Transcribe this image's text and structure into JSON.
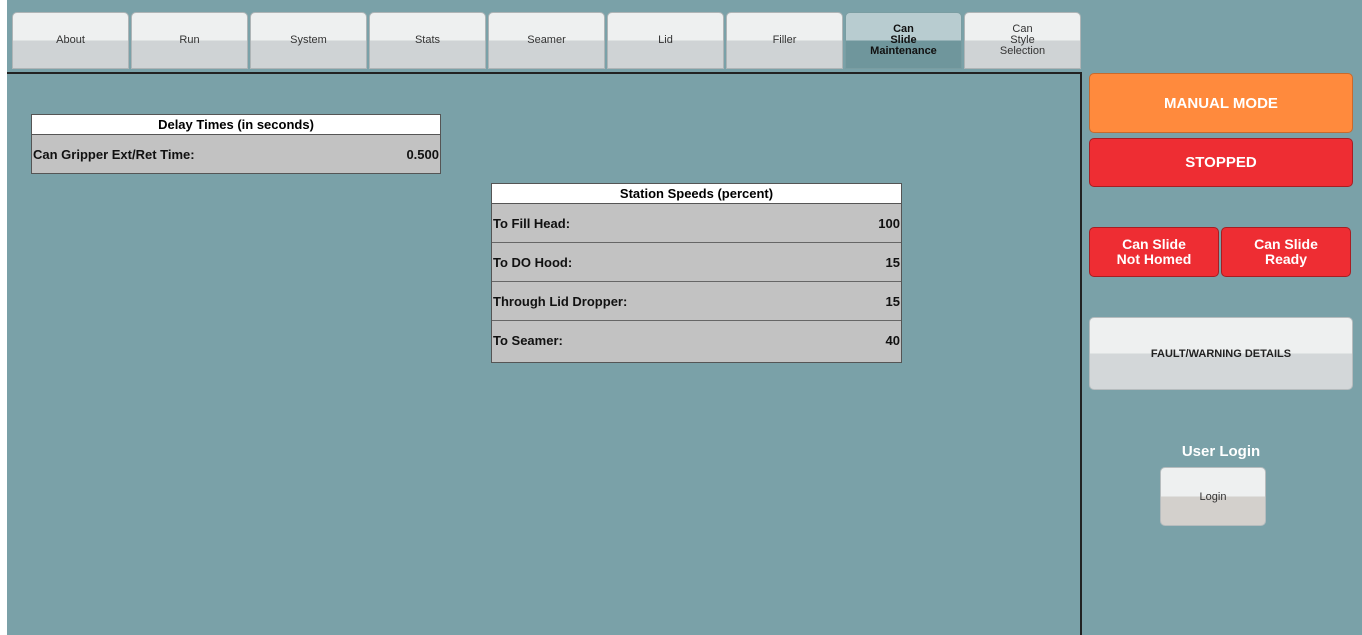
{
  "tabs": [
    {
      "label": "About",
      "active": false
    },
    {
      "label": "Run",
      "active": false
    },
    {
      "label": "System",
      "active": false
    },
    {
      "label": "Stats",
      "active": false
    },
    {
      "label": "Seamer",
      "active": false
    },
    {
      "label": "Lid",
      "active": false
    },
    {
      "label": "Filler",
      "active": false
    },
    {
      "label": "Can\nSlide\nMaintenance",
      "active": true
    },
    {
      "label": "Can\nStyle\nSelection",
      "active": false
    }
  ],
  "delay_times": {
    "title": "Delay Times (in seconds)",
    "rows": [
      {
        "label": "Can Gripper Ext/Ret Time:",
        "value": "0.500"
      }
    ]
  },
  "station_speeds": {
    "title": "Station Speeds (percent)",
    "rows": [
      {
        "label": "To Fill Head:",
        "value": "100"
      },
      {
        "label": "To DO Hood:",
        "value": "15"
      },
      {
        "label": "Through Lid Dropper:",
        "value": "15"
      },
      {
        "label": "To Seamer:",
        "value": "40"
      }
    ]
  },
  "status": {
    "mode": "MANUAL MODE",
    "state": "STOPPED",
    "can_slide_homed": "Can Slide\nNot Homed",
    "can_slide_ready": "Can Slide\nReady",
    "fault_button": "FAULT/WARNING DETAILS"
  },
  "login": {
    "title": "User Login",
    "button": "Login"
  },
  "colors": {
    "background": "#7aa1a8",
    "manual_mode": "#ff8a3d",
    "alarm_red": "#ee2d33"
  }
}
